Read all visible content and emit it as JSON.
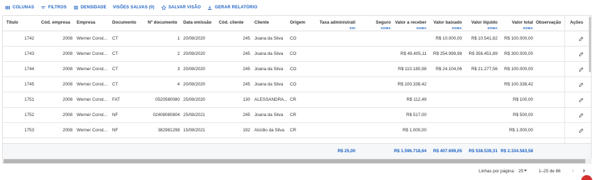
{
  "toolbar": {
    "columns": "COLUNAS",
    "filters": "FILTROS",
    "density": "DENSIDADE",
    "saved_views": "VISÕES SALVAS (0)",
    "save_view": "SALVAR VISÃO",
    "report": "GERAR RELATÓRIO"
  },
  "columns": {
    "titulo": "Título",
    "cod_empresa": "Cód. empresa",
    "empresa": "Empresa",
    "documento": "Documento",
    "n_documento": "Nº documento",
    "data_emissao": "Data emissão",
    "cod_cliente": "Cód. cliente",
    "cliente": "Cliente",
    "origem": "Origem",
    "taxa_admin": "Taxa administrati",
    "seguro": "Seguro",
    "valor_receber": "Valor a receber",
    "valor_baixado": "Valor baixado",
    "valor_liquido": "Valor líquido",
    "valor_total": "Valor total",
    "observacao": "Observação",
    "acoes": "Ações",
    "sum_label": "SOMA",
    "sum_label_short": "SOI"
  },
  "rows": [
    {
      "titulo": "1742",
      "cod_empresa": "2008",
      "empresa": "Werner Const...",
      "documento": "CT",
      "n_documento": "1",
      "data_emissao": "20/08/2020",
      "cod_cliente": "245",
      "cliente": "Joana da Silva",
      "origem": "CO",
      "taxa": "",
      "seguro": "",
      "valor_receber": "",
      "valor_baixado": "R$ 10.000,00",
      "valor_liquido": "R$ 10.541,82",
      "valor_total": "R$ 100.000,00"
    },
    {
      "titulo": "1743",
      "cod_empresa": "2008",
      "empresa": "Werner Const...",
      "documento": "CT",
      "n_documento": "2",
      "data_emissao": "20/08/2020",
      "cod_cliente": "245",
      "cliente": "Joana da Silva",
      "origem": "CO",
      "taxa": "",
      "seguro": "",
      "valor_receber": "R$ 49.405,11",
      "valor_baixado": "R$ 254.999,98",
      "valor_liquido": "R$ 356.451,89",
      "valor_total": "R$ 300.000,00"
    },
    {
      "titulo": "1744",
      "cod_empresa": "2008",
      "empresa": "Werner Const...",
      "documento": "CT",
      "n_documento": "3",
      "data_emissao": "20/08/2020",
      "cod_cliente": "245",
      "cliente": "Joana da Silva",
      "origem": "CO",
      "taxa": "",
      "seguro": "",
      "valor_receber": "R$ 110.180,98",
      "valor_baixado": "R$ 24.104,06",
      "valor_liquido": "R$ 21.277,56",
      "valor_total": "R$ 100.000,00"
    },
    {
      "titulo": "1745",
      "cod_empresa": "2008",
      "empresa": "Werner Const...",
      "documento": "CT",
      "n_documento": "4",
      "data_emissao": "20/08/2020",
      "cod_cliente": "245",
      "cliente": "Joana da Silva",
      "origem": "CO",
      "taxa": "",
      "seguro": "",
      "valor_receber": "R$ 100.338,42",
      "valor_baixado": "",
      "valor_liquido": "",
      "valor_total": "R$ 100.338,42"
    },
    {
      "titulo": "1751",
      "cod_empresa": "2008",
      "empresa": "Werner Const...",
      "documento": "FAT",
      "n_documento": "0520580080",
      "data_emissao": "25/08/2020",
      "cod_cliente": "130",
      "cliente": "ALESSANDRA...",
      "origem": "CR",
      "taxa": "",
      "seguro": "",
      "valor_receber": "R$ 112,49",
      "valor_baixado": "",
      "valor_liquido": "",
      "valor_total": "R$ 100,00"
    },
    {
      "titulo": "1752",
      "cod_empresa": "2008",
      "empresa": "Werner Const...",
      "documento": "NF",
      "n_documento": "02408080804",
      "data_emissao": "25/08/2021",
      "cod_cliente": "245",
      "cliente": "Joana da Silva",
      "origem": "CR",
      "taxa": "",
      "seguro": "",
      "valor_receber": "R$ 517,00",
      "valor_baixado": "",
      "valor_liquido": "",
      "valor_total": "R$ 500,00"
    },
    {
      "titulo": "1753",
      "cod_empresa": "2008",
      "empresa": "Werner Const...",
      "documento": "NF",
      "n_documento": "382981298",
      "data_emissao": "15/08/2021",
      "cod_cliente": "192",
      "cliente": "Alcídio da Silva",
      "origem": "CR",
      "taxa": "",
      "seguro": "",
      "valor_receber": "R$ 1.000,00",
      "valor_baixado": "",
      "valor_liquido": "",
      "valor_total": "R$ 1.000,00"
    }
  ],
  "totals": {
    "taxa": "R$ 25,00",
    "valor_receber": "R$ 1.596.718,64",
    "valor_baixado": "R$ 407.699,05",
    "valor_liquido": "R$ 538.539,31",
    "valor_total": "R$ 2.334.583,58"
  },
  "footer": {
    "rows_per_page_label": "Linhas por página:",
    "rows_per_page_value": "25",
    "range": "1–25 de 86"
  },
  "icons": {
    "columns": "columns-icon",
    "filters": "filter-icon",
    "density": "density-icon",
    "save_view": "star-outline-icon",
    "report": "download-icon",
    "edit": "pencil-icon"
  },
  "colors": {
    "accent": "#1e62c4",
    "fab": "#d32f2f"
  }
}
